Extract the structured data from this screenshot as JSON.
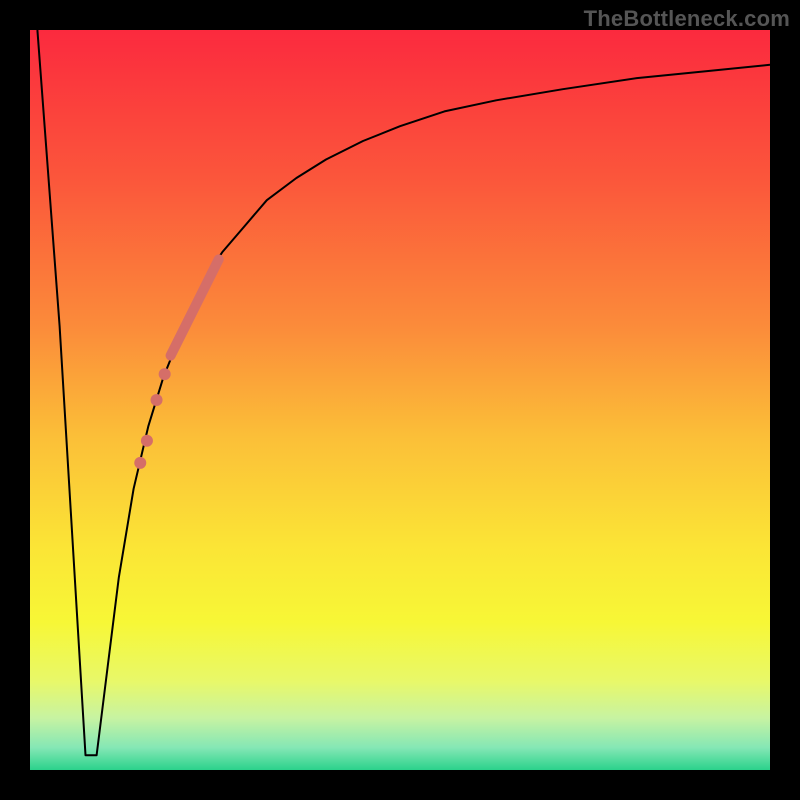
{
  "watermark": "TheBottleneck.com",
  "chart_data": {
    "type": "line",
    "title": "",
    "xlabel": "",
    "ylabel": "",
    "xlim": [
      0,
      100
    ],
    "ylim": [
      0,
      100
    ],
    "grid": false,
    "legend": false,
    "background_gradient": {
      "stops": [
        {
          "t": 0.0,
          "color": "#fb2a3e"
        },
        {
          "t": 0.2,
          "color": "#fb563b"
        },
        {
          "t": 0.4,
          "color": "#fb8b3a"
        },
        {
          "t": 0.55,
          "color": "#fbbf38"
        },
        {
          "t": 0.7,
          "color": "#fbe536"
        },
        {
          "t": 0.8,
          "color": "#f7f736"
        },
        {
          "t": 0.88,
          "color": "#e8f869"
        },
        {
          "t": 0.93,
          "color": "#c7f3a2"
        },
        {
          "t": 0.97,
          "color": "#84e7b5"
        },
        {
          "t": 1.0,
          "color": "#2bd28b"
        }
      ]
    },
    "series": [
      {
        "name": "curve",
        "stroke": "#000000",
        "stroke_width": 2,
        "x": [
          1,
          4,
          7.5,
          9,
          10.5,
          12,
          14,
          16,
          18,
          20,
          22,
          24,
          26,
          29,
          32,
          36,
          40,
          45,
          50,
          56,
          63,
          72,
          82,
          92,
          100
        ],
        "y": [
          100,
          60,
          2,
          2,
          14,
          26,
          38,
          46.5,
          53,
          58,
          63,
          67,
          70,
          73.5,
          77,
          80,
          82.5,
          85,
          87,
          89,
          90.5,
          92,
          93.5,
          94.5,
          95.3
        ]
      }
    ],
    "highlight": {
      "name": "highlight-segment",
      "color": "#d56e68",
      "stroke_width": 10,
      "x_start": 19,
      "x_end": 25.5,
      "y_start": 56,
      "y_end": 69
    },
    "dots": {
      "name": "highlight-dots",
      "color": "#d56e68",
      "radius": 6,
      "points": [
        {
          "x": 18.2,
          "y": 53.5
        },
        {
          "x": 17.1,
          "y": 50
        },
        {
          "x": 15.8,
          "y": 44.5
        },
        {
          "x": 14.9,
          "y": 41.5
        }
      ]
    }
  }
}
